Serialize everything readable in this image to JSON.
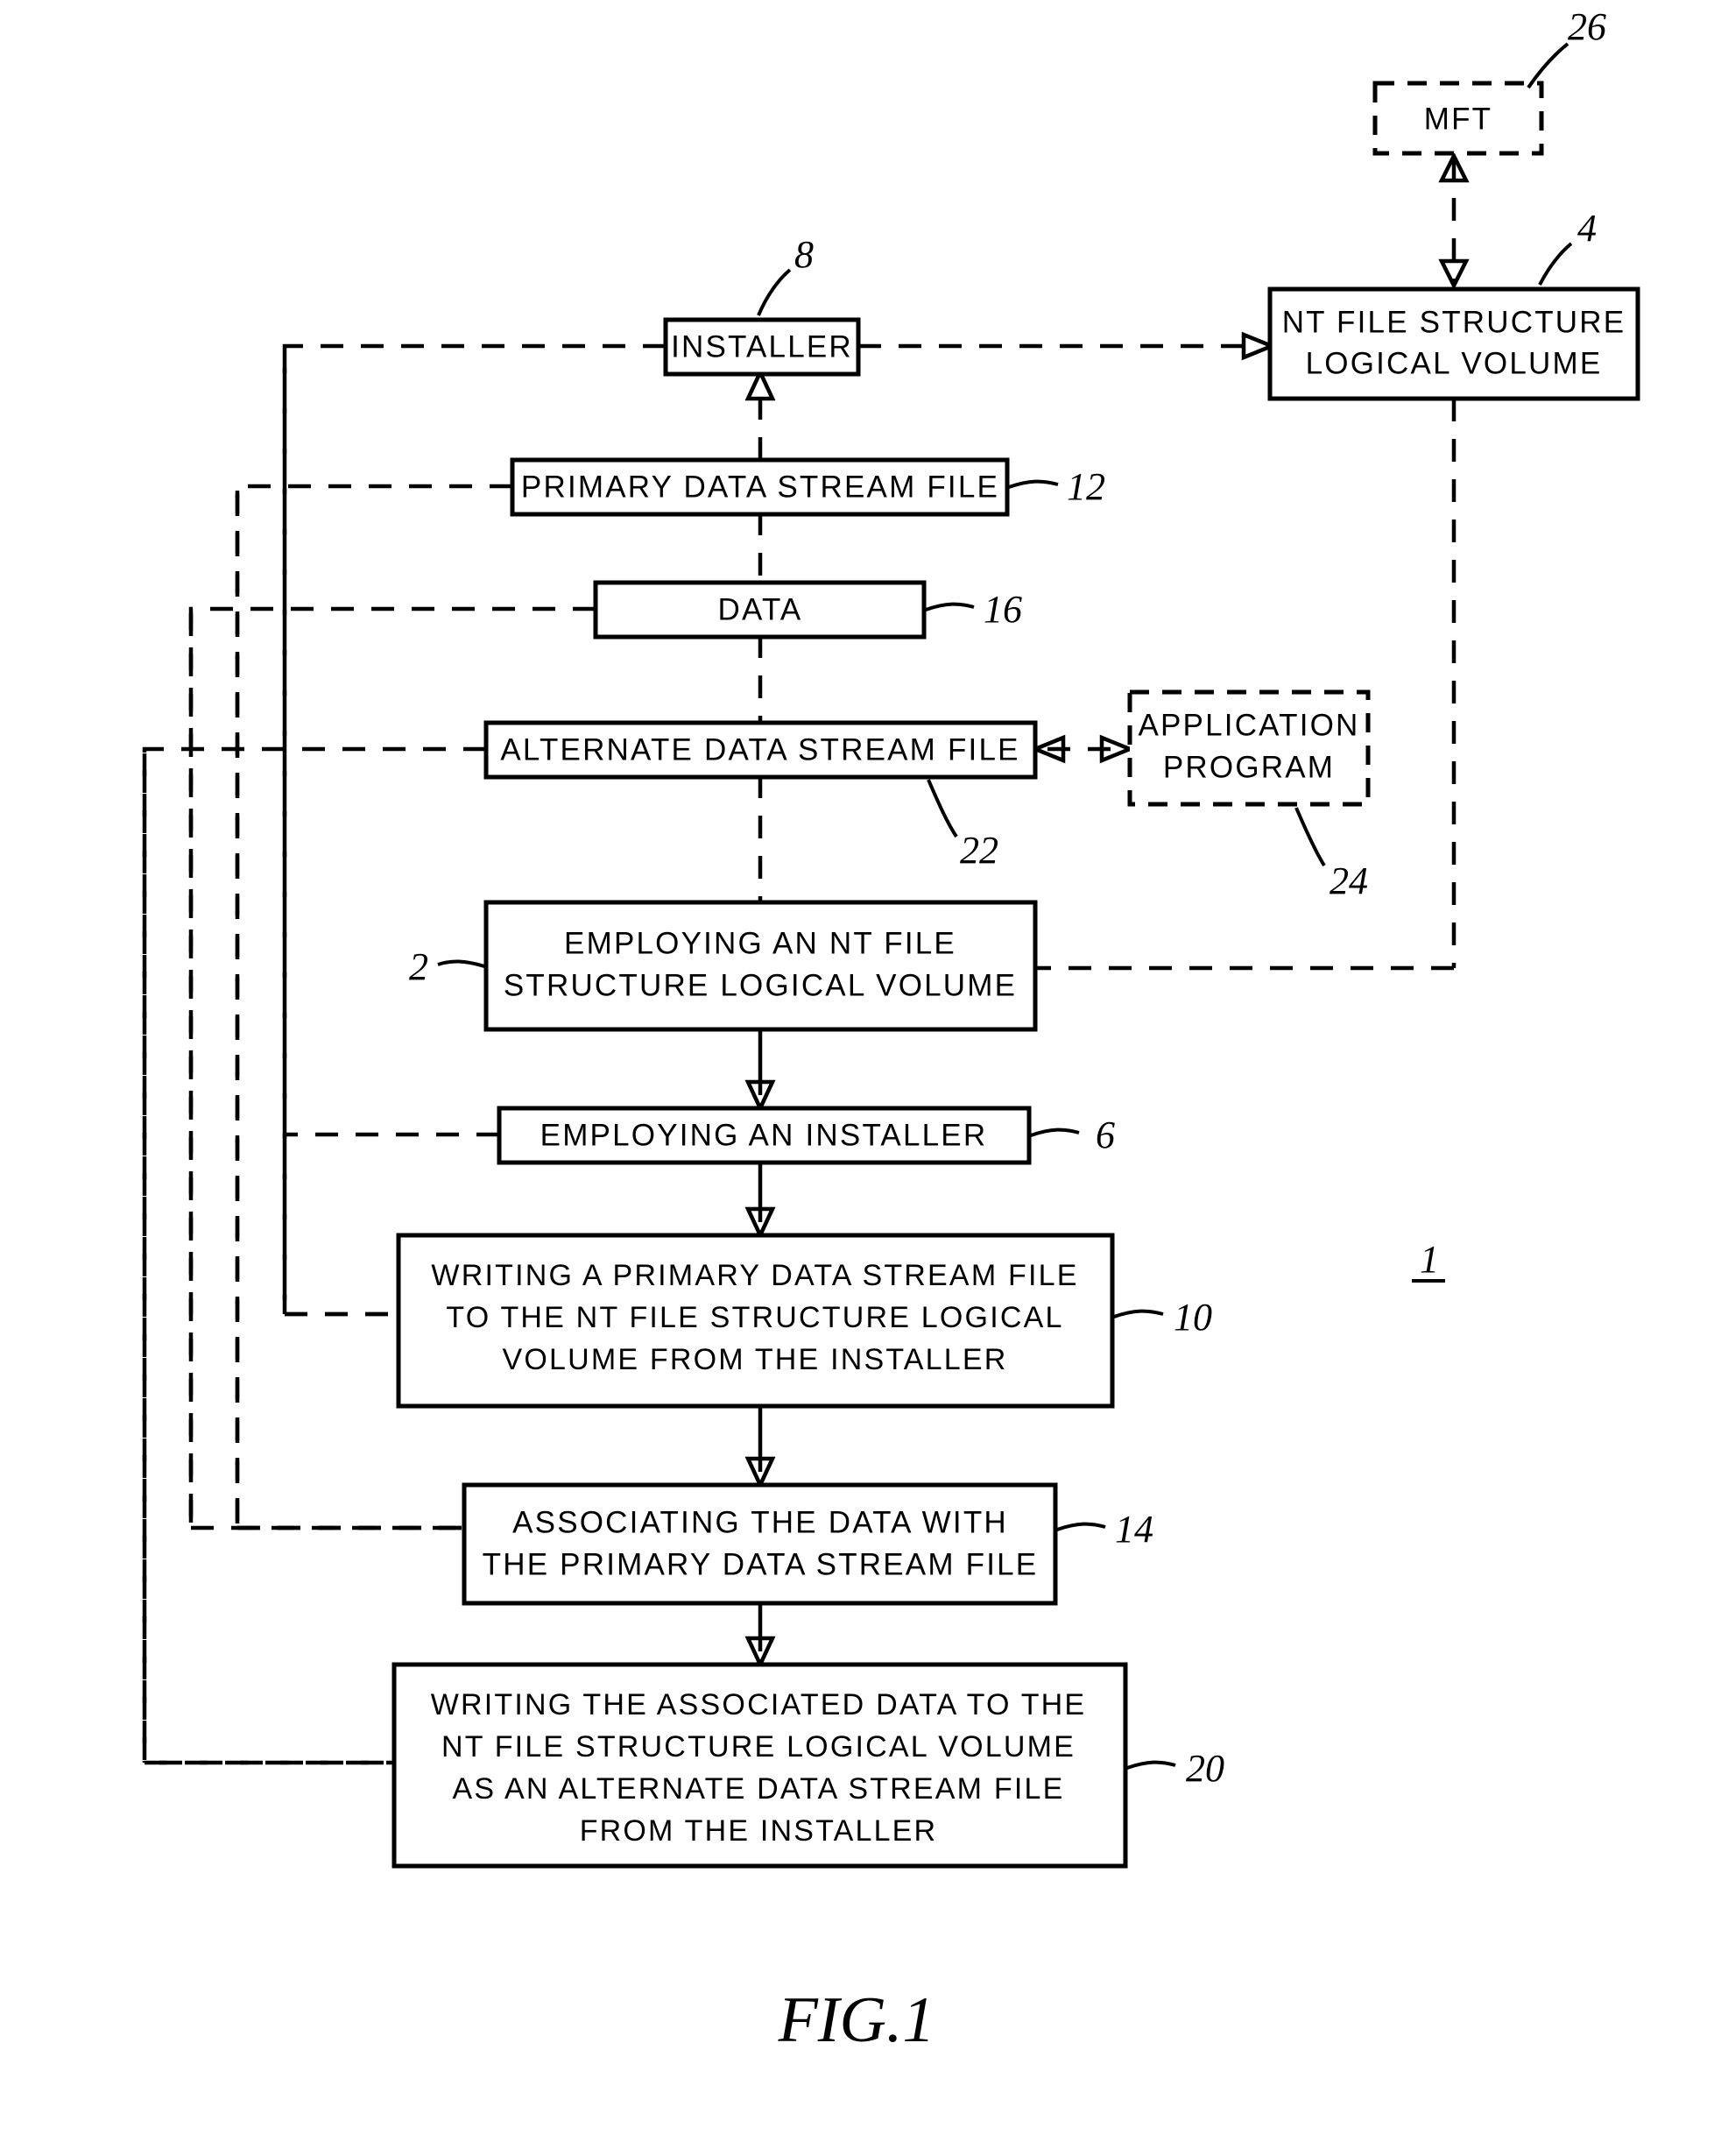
{
  "figure": {
    "caption": "FIG.1",
    "system_ref": "1"
  },
  "boxes": {
    "mft": {
      "label": "MFT",
      "ref": "26",
      "style": "dashed"
    },
    "nt_volume": {
      "line1": "NT FILE STRUCTURE",
      "line2": "LOGICAL VOLUME",
      "ref": "4",
      "style": "solid"
    },
    "installer": {
      "label": "INSTALLER",
      "ref": "8",
      "style": "solid"
    },
    "primary_data_stream_file": {
      "label": "PRIMARY DATA STREAM FILE",
      "ref": "12",
      "style": "solid"
    },
    "data": {
      "label": "DATA",
      "ref": "16",
      "style": "solid"
    },
    "alternate_data_stream_file": {
      "label": "ALTERNATE DATA STREAM FILE",
      "ref": "22",
      "style": "solid"
    },
    "application_program": {
      "line1": "APPLICATION",
      "line2": "PROGRAM",
      "ref": "24",
      "style": "dashed"
    },
    "step_employing_volume": {
      "line1": "EMPLOYING AN NT FILE",
      "line2": "STRUCTURE LOGICAL VOLUME",
      "ref": "2",
      "style": "solid"
    },
    "step_employing_installer": {
      "label": "EMPLOYING AN INSTALLER",
      "ref": "6",
      "style": "solid"
    },
    "step_writing_primary": {
      "line1": "WRITING A PRIMARY DATA STREAM FILE",
      "line2": "TO THE NT FILE STRUCTURE LOGICAL",
      "line3": "VOLUME FROM THE INSTALLER",
      "ref": "10",
      "style": "solid"
    },
    "step_associating": {
      "line1": "ASSOCIATING THE DATA WITH",
      "line2": "THE PRIMARY DATA STREAM FILE",
      "ref": "14",
      "style": "solid"
    },
    "step_writing_associated": {
      "line1": "WRITING THE ASSOCIATED DATA TO THE",
      "line2": "NT FILE STRUCTURE LOGICAL VOLUME",
      "line3": "AS AN ALTERNATE DATA STREAM FILE",
      "line4": "FROM THE INSTALLER",
      "ref": "20",
      "style": "solid"
    }
  },
  "colors": {
    "ink": "#000000",
    "paper": "#ffffff"
  }
}
